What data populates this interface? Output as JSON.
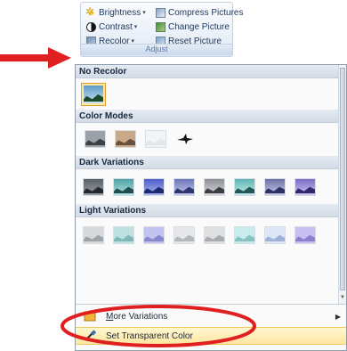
{
  "ribbon": {
    "left": [
      {
        "label": "Brightness",
        "icon": "brightness-icon",
        "has_caret": true
      },
      {
        "label": "Contrast",
        "icon": "contrast-icon",
        "has_caret": true
      },
      {
        "label": "Recolor",
        "icon": "recolor-icon",
        "has_caret": true
      }
    ],
    "right": [
      {
        "label": "Compress Pictures",
        "icon": "compress-pictures-icon"
      },
      {
        "label": "Change Picture",
        "icon": "change-picture-icon"
      },
      {
        "label": "Reset Picture",
        "icon": "reset-picture-icon"
      }
    ],
    "group_label": "Adjust"
  },
  "gallery": {
    "no_recolor_header": "No Recolor",
    "color_modes_header": "Color Modes",
    "dark_variations_header": "Dark Variations",
    "light_variations_header": "Light Variations",
    "color_modes": [
      "#9aa2a8",
      "#c9a98a",
      "#f1f4f8"
    ],
    "dark_variations": [
      "#5b6168",
      "#4fa3a6",
      "#4d5fc8",
      "#6d77bd",
      "#8f9196",
      "#5fb5b5",
      "#6b72a8",
      "#7c6ac6"
    ],
    "light_variations": [
      "#d7dadd",
      "#bfe1e1",
      "#c3c3ef",
      "#e6e7ea",
      "#dfe0e2",
      "#c8ebeb",
      "#dfe7f6",
      "#c8c0f1"
    ]
  },
  "menu": {
    "more_variations": "More Variations",
    "set_transparent_color": "Set Transparent Color"
  },
  "colors": {
    "annotation_red": "#e02020",
    "ribbon_text": "#1e395b"
  }
}
